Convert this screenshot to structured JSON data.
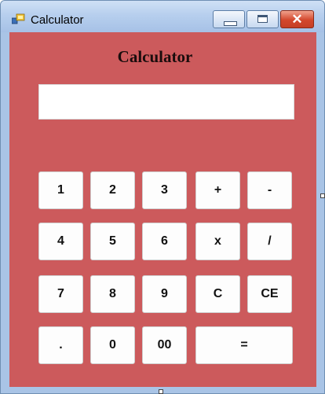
{
  "window": {
    "title": "Calculator",
    "icon": "app-windows-icon",
    "controls": {
      "minimize_icon": "minimize-icon",
      "maximize_icon": "maximize-icon",
      "close_glyph": "✕"
    }
  },
  "app": {
    "heading": "Calculator",
    "display": {
      "value": "",
      "placeholder": ""
    }
  },
  "keys": [
    [
      "1",
      "2",
      "3",
      "+",
      "-"
    ],
    [
      "4",
      "5",
      "6",
      "x",
      "/"
    ],
    [
      "7",
      "8",
      "9",
      "C",
      "CE"
    ],
    [
      ".",
      "0",
      "00",
      "="
    ]
  ],
  "colors": {
    "client_background": "#cc5a5c",
    "key_background": "#fdfdfd",
    "titlebar": "#b7cfee",
    "close_button": "#d3472c"
  }
}
